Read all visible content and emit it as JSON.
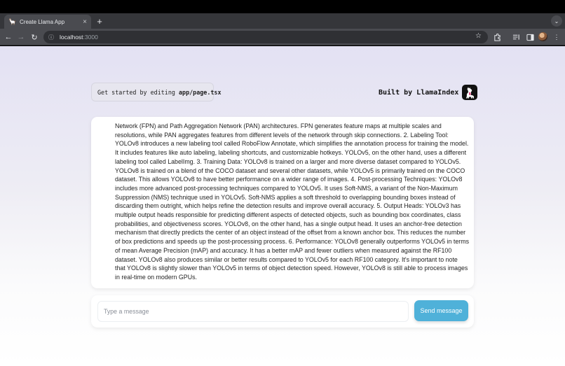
{
  "browser": {
    "tab_title": "Create Llama App",
    "new_tab_glyph": "+",
    "address_host": "localhost",
    "address_port": ":3000",
    "icons": [
      "back-arrow-icon",
      "forward-arrow-icon",
      "reload-icon",
      "site-info-icon",
      "bookmark-star-icon",
      "extensions-icon",
      "reading-list-icon",
      "side-panel-icon",
      "profile-avatar",
      "kebab-menu-icon"
    ]
  },
  "header": {
    "started_prefix": "Get started by editing ",
    "started_file": "app/page.tsx",
    "built_by": "Built by LlamaIndex"
  },
  "chat": {
    "message": "Network (FPN) and Path Aggregation Network (PAN) architectures. FPN generates feature maps at multiple scales and resolutions, while PAN aggregates features from different levels of the network through skip connections. 2. Labeling Tool: YOLOv8 introduces a new labeling tool called RoboFlow Annotate, which simplifies the annotation process for training the model. It includes features like auto labeling, labeling shortcuts, and customizable hotkeys. YOLOv5, on the other hand, uses a different labeling tool called LabelImg. 3. Training Data: YOLOv8 is trained on a larger and more diverse dataset compared to YOLOv5. YOLOv8 is trained on a blend of the COCO dataset and several other datasets, while YOLOv5 is primarily trained on the COCO dataset. This allows YOLOv8 to have better performance on a wider range of images. 4. Post-processing Techniques: YOLOv8 includes more advanced post-processing techniques compared to YOLOv5. It uses Soft-NMS, a variant of the Non-Maximum Suppression (NMS) technique used in YOLOv5. Soft-NMS applies a soft threshold to overlapping bounding boxes instead of discarding them outright, which helps refine the detection results and improve overall accuracy. 5. Output Heads: YOLOv3 has multiple output heads responsible for predicting different aspects of detected objects, such as bounding box coordinates, class probabilities, and objectiveness scores. YOLOv8, on the other hand, has a single output head. It uses an anchor-free detection mechanism that directly predicts the center of an object instead of the offset from a known anchor box. This reduces the number of box predictions and speeds up the post-processing process. 6. Performance: YOLOv8 generally outperforms YOLOv5 in terms of mean Average Precision (mAP) and accuracy. It has a better mAP and fewer outliers when measured against the RF100 dataset. YOLOv8 also produces similar or better results compared to YOLOv5 for each RF100 category. It's important to note that YOLOv8 is slightly slower than YOLOv5 in terms of object detection speed. However, YOLOv8 is still able to process images in real-time on modern GPUs.",
    "input_value": "",
    "input_placeholder": "Type a message",
    "send_label": "Send message"
  },
  "colors": {
    "send_button": "#4fb1d9",
    "page_gradient_top": "#e3e1f3",
    "browser_frame": "#35363a"
  }
}
